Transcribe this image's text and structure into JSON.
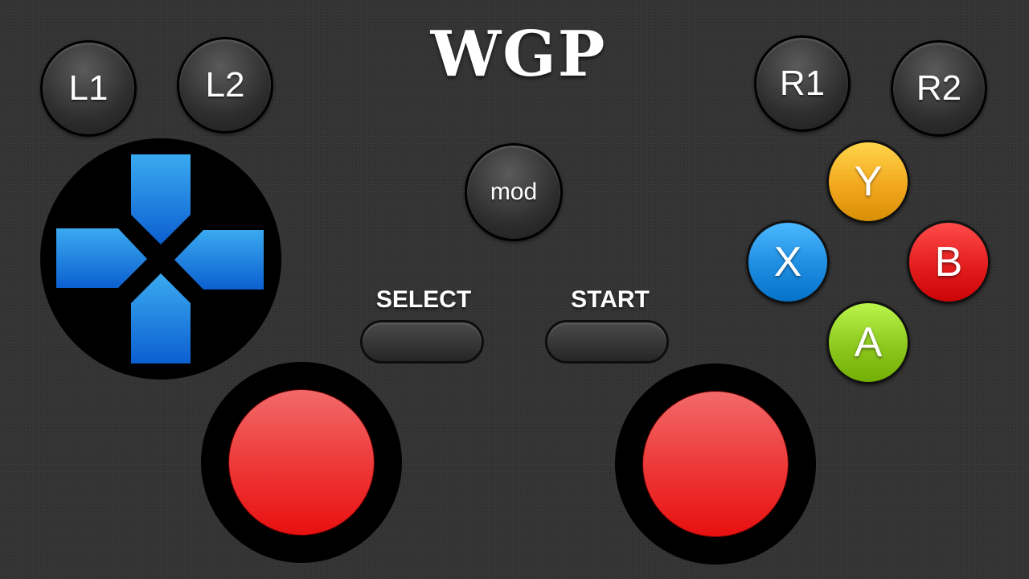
{
  "app": {
    "title": "WGP"
  },
  "shoulder_buttons": {
    "l1": "L1",
    "l2": "L2",
    "r1": "R1",
    "r2": "R2"
  },
  "center": {
    "mod_label": "mod",
    "select_label": "SELECT",
    "start_label": "START"
  },
  "face_buttons": {
    "y": {
      "label": "Y",
      "color": "#F2A81E"
    },
    "x": {
      "label": "X",
      "color": "#1E8CE0"
    },
    "b": {
      "label": "B",
      "color": "#E41E1E"
    },
    "a": {
      "label": "A",
      "color": "#8CC81E"
    }
  },
  "dpad": {
    "color": "#1E88E5",
    "icon": "dpad-icon"
  },
  "sticks": {
    "color": "#EE2A2A"
  }
}
